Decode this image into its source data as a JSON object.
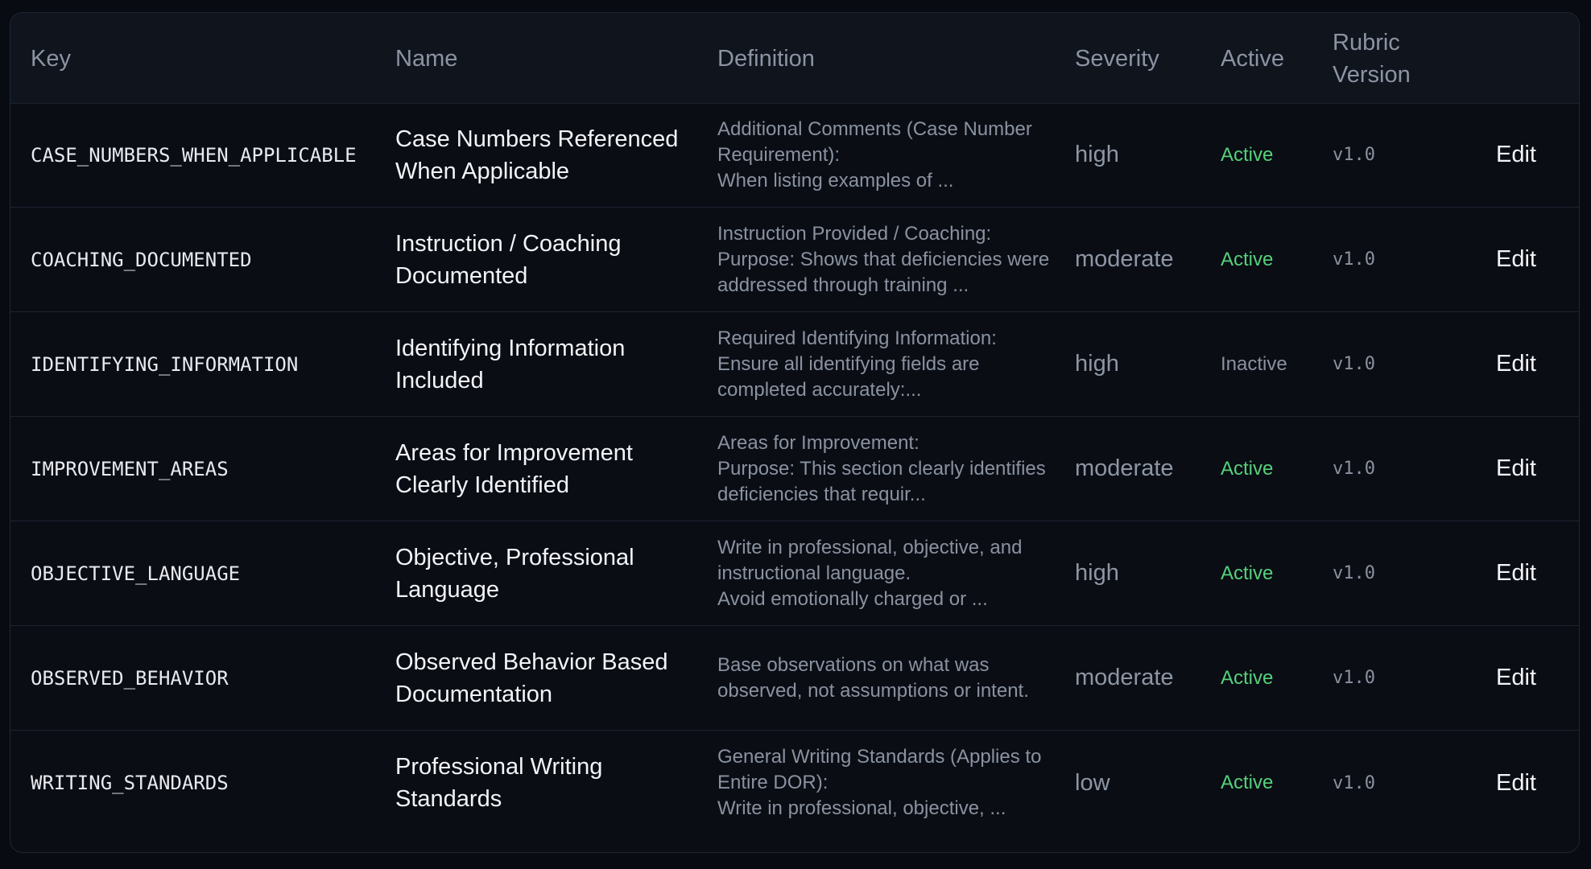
{
  "table": {
    "headers": {
      "key": "Key",
      "name": "Name",
      "definition": "Definition",
      "severity": "Severity",
      "active": "Active",
      "rubric_version_line1": "Rubric",
      "rubric_version_line2": "Version"
    },
    "rows": [
      {
        "key": "CASE_NUMBERS_WHEN_APPLICABLE",
        "name": "Case Numbers Referenced When Applicable",
        "definition": "Additional Comments (Case Number Requirement):\nWhen listing examples of ...",
        "severity": "high",
        "active": "Active",
        "active_state": "on",
        "version": "v1.0",
        "edit": "Edit"
      },
      {
        "key": "COACHING_DOCUMENTED",
        "name": "Instruction / Coaching Documented",
        "definition": "Instruction Provided / Coaching:\nPurpose: Shows that deficiencies were addressed through training ...",
        "severity": "moderate",
        "active": "Active",
        "active_state": "on",
        "version": "v1.0",
        "edit": "Edit"
      },
      {
        "key": "IDENTIFYING_INFORMATION",
        "name": "Identifying Information Included",
        "definition": "Required Identifying Information:\nEnsure all identifying fields are completed accurately:...",
        "severity": "high",
        "active": "Inactive",
        "active_state": "off",
        "version": "v1.0",
        "edit": "Edit"
      },
      {
        "key": "IMPROVEMENT_AREAS",
        "name": "Areas for Improvement Clearly Identified",
        "definition": "Areas for Improvement:\nPurpose: This section clearly identifies deficiencies that requir...",
        "severity": "moderate",
        "active": "Active",
        "active_state": "on",
        "version": "v1.0",
        "edit": "Edit"
      },
      {
        "key": "OBJECTIVE_LANGUAGE",
        "name": "Objective, Professional Language",
        "definition": "Write in professional, objective, and instructional language.\nAvoid emotionally charged or ...",
        "severity": "high",
        "active": "Active",
        "active_state": "on",
        "version": "v1.0",
        "edit": "Edit"
      },
      {
        "key": "OBSERVED_BEHAVIOR",
        "name": "Observed Behavior Based Documentation",
        "definition": "Base observations on what was observed, not assumptions or intent.",
        "severity": "moderate",
        "active": "Active",
        "active_state": "on",
        "version": "v1.0",
        "edit": "Edit"
      },
      {
        "key": "WRITING_STANDARDS",
        "name": "Professional Writing Standards",
        "definition": "General Writing Standards (Applies to Entire DOR):\nWrite in professional, objective, ...",
        "severity": "low",
        "active": "Active",
        "active_state": "on",
        "version": "v1.0",
        "edit": "Edit"
      }
    ]
  },
  "colors": {
    "active": "#55d17a",
    "inactive": "#8a92a0",
    "background": "#0a0d14",
    "header_background": "#0f141d"
  }
}
